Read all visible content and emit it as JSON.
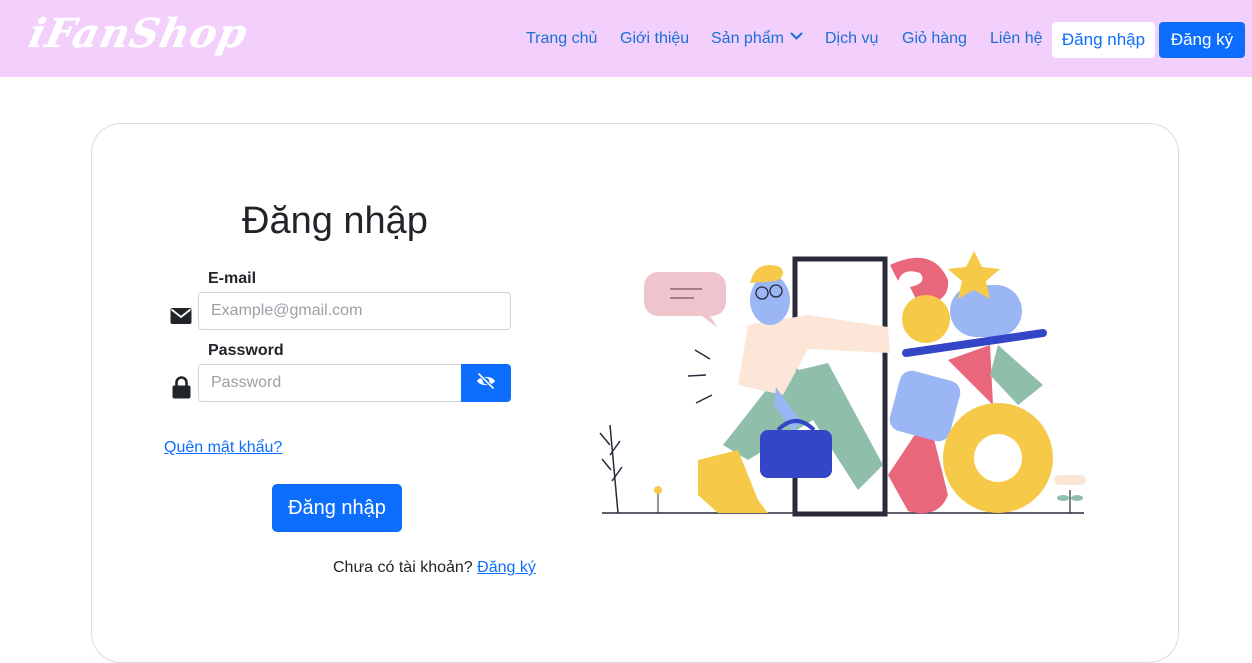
{
  "brand": {
    "logo": "iFanShop"
  },
  "nav": {
    "items": [
      {
        "label": "Trang chủ"
      },
      {
        "label": "Giới thiệu"
      },
      {
        "label": "Sản phẩm"
      },
      {
        "label": "Dịch vụ"
      },
      {
        "label": "Giỏ hàng"
      },
      {
        "label": "Liên hệ"
      }
    ],
    "login_label": "Đăng nhập",
    "register_label": "Đăng ký"
  },
  "form": {
    "title": "Đăng nhập",
    "email_label": "E-mail",
    "email_placeholder": "Example@gmail.com",
    "email_value": "",
    "password_label": "Password",
    "password_placeholder": "Password",
    "password_value": "",
    "forgot_label": "Quên mật khẩu?",
    "submit_label": "Đăng nhập",
    "no_account_text": "Chưa có tài khoản? ",
    "register_link": "Đăng ký"
  },
  "icons": {
    "email": "envelope-icon",
    "password": "lock-icon",
    "toggle": "eye-slash-icon",
    "dropdown": "chevron-down-icon"
  },
  "colors": {
    "navbar_bg": "#f3d0fb",
    "primary": "#0d6efd",
    "nav_link": "#1a6fd8"
  }
}
